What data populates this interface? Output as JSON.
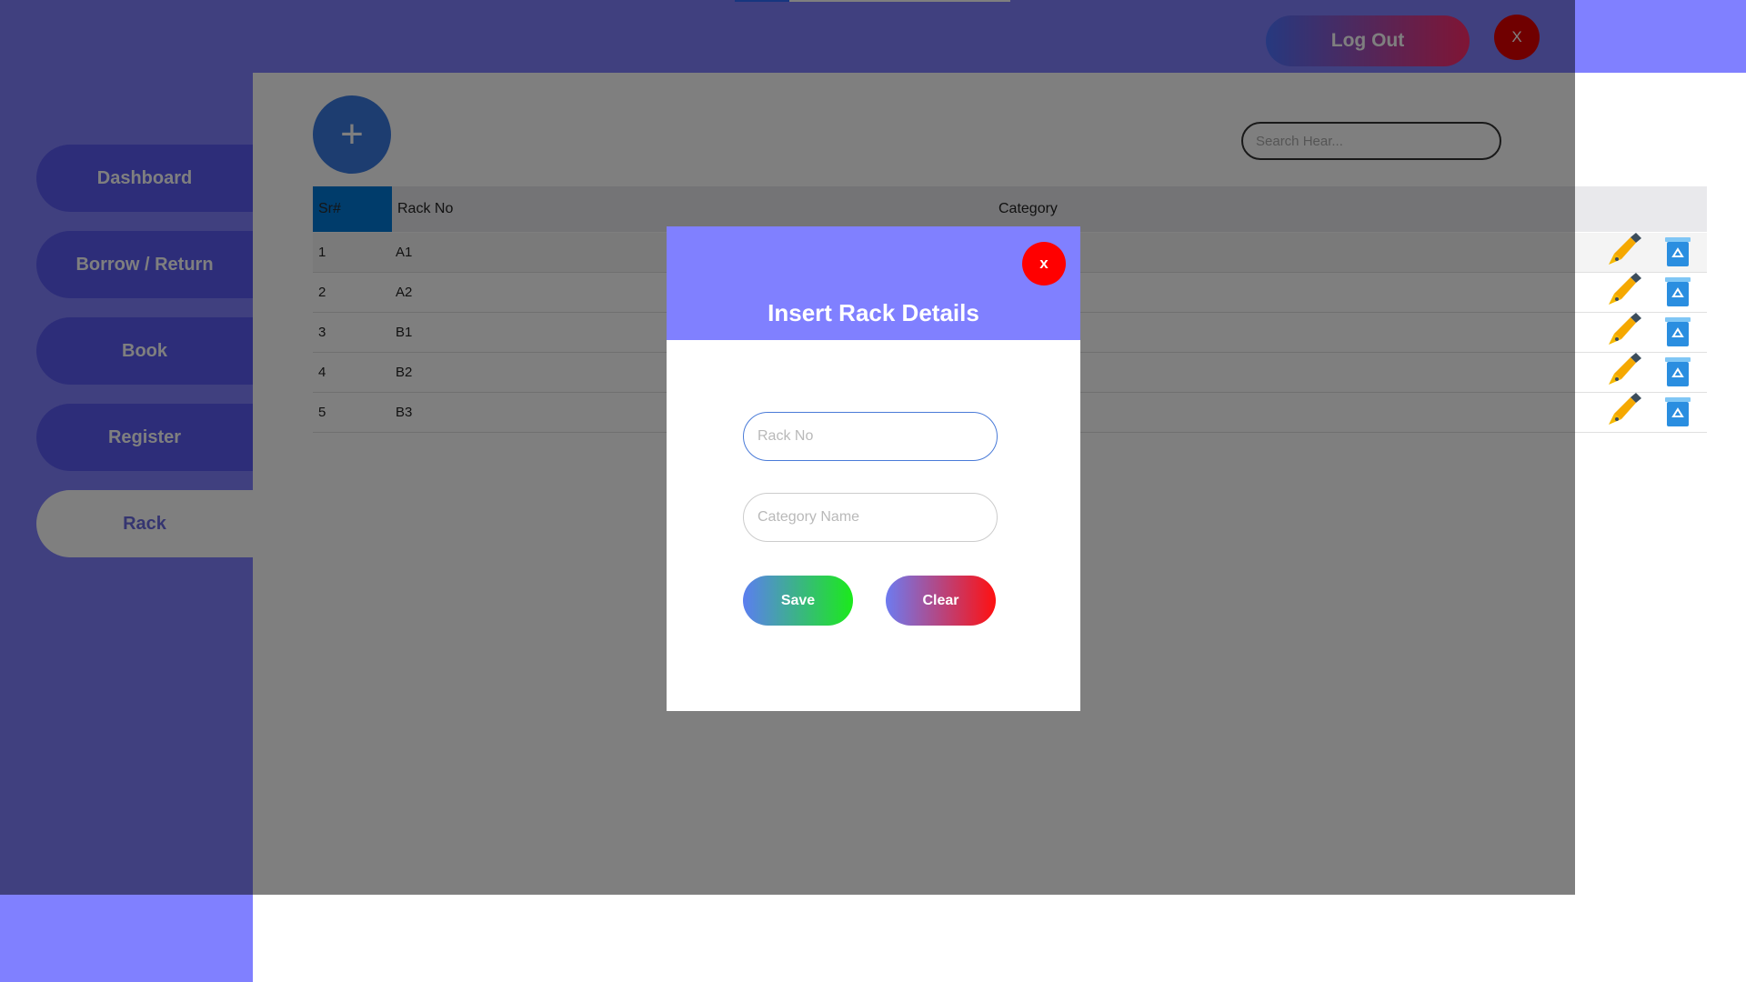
{
  "topbar": {
    "logout_label": "Log Out",
    "close_label": "X"
  },
  "sidebar": {
    "items": [
      {
        "label": "Dashboard",
        "active": false
      },
      {
        "label": "Borrow / Return",
        "active": false
      },
      {
        "label": "Book",
        "active": false
      },
      {
        "label": "Register",
        "active": false
      },
      {
        "label": "Rack",
        "active": true
      }
    ]
  },
  "content": {
    "add_label": "+",
    "search": {
      "placeholder": "Search Hear...",
      "value": ""
    },
    "table": {
      "headers": {
        "sr": "Sr#",
        "rack_no": "Rack No",
        "category": "Category"
      },
      "rows": [
        {
          "sr": "1",
          "rack_no": "A1",
          "category": ""
        },
        {
          "sr": "2",
          "rack_no": "A2",
          "category": ""
        },
        {
          "sr": "3",
          "rack_no": "B1",
          "category": ""
        },
        {
          "sr": "4",
          "rack_no": "B2",
          "category": ""
        },
        {
          "sr": "5",
          "rack_no": "B3",
          "category": ""
        }
      ]
    }
  },
  "modal": {
    "title": "Insert Rack Details",
    "close_label": "x",
    "rack_no": {
      "placeholder": "Rack No",
      "value": ""
    },
    "category": {
      "placeholder": "Category Name",
      "value": ""
    },
    "save_label": "Save",
    "clear_label": "Clear"
  },
  "icons": {
    "edit": "pen-icon",
    "delete": "recycle-bin-icon",
    "add": "plus-icon"
  },
  "colors": {
    "accent": "#8080ff",
    "sidebar_item": "#5a5af2",
    "header_highlight": "#0078d7",
    "close_red": "#ff0000"
  }
}
